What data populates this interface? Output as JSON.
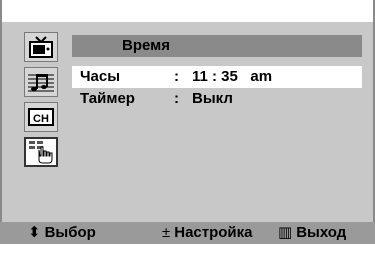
{
  "menu": {
    "title": "Время",
    "icons": [
      "tv-icon",
      "music-note-icon",
      "channel-icon",
      "settings-hand-icon"
    ],
    "channel_icon_text": "CH",
    "rows": [
      {
        "label": "Часы",
        "colon": ":",
        "value": "11 : 35   am",
        "selected": true
      },
      {
        "label": "Таймер",
        "colon": ":",
        "value": "Выкл",
        "selected": false
      }
    ]
  },
  "hints": {
    "select_symbol": "⬍",
    "select_label": "Выбор",
    "adjust_symbol": "±",
    "adjust_label": "Настройка",
    "exit_symbol": "▥",
    "exit_label": "Выход"
  }
}
